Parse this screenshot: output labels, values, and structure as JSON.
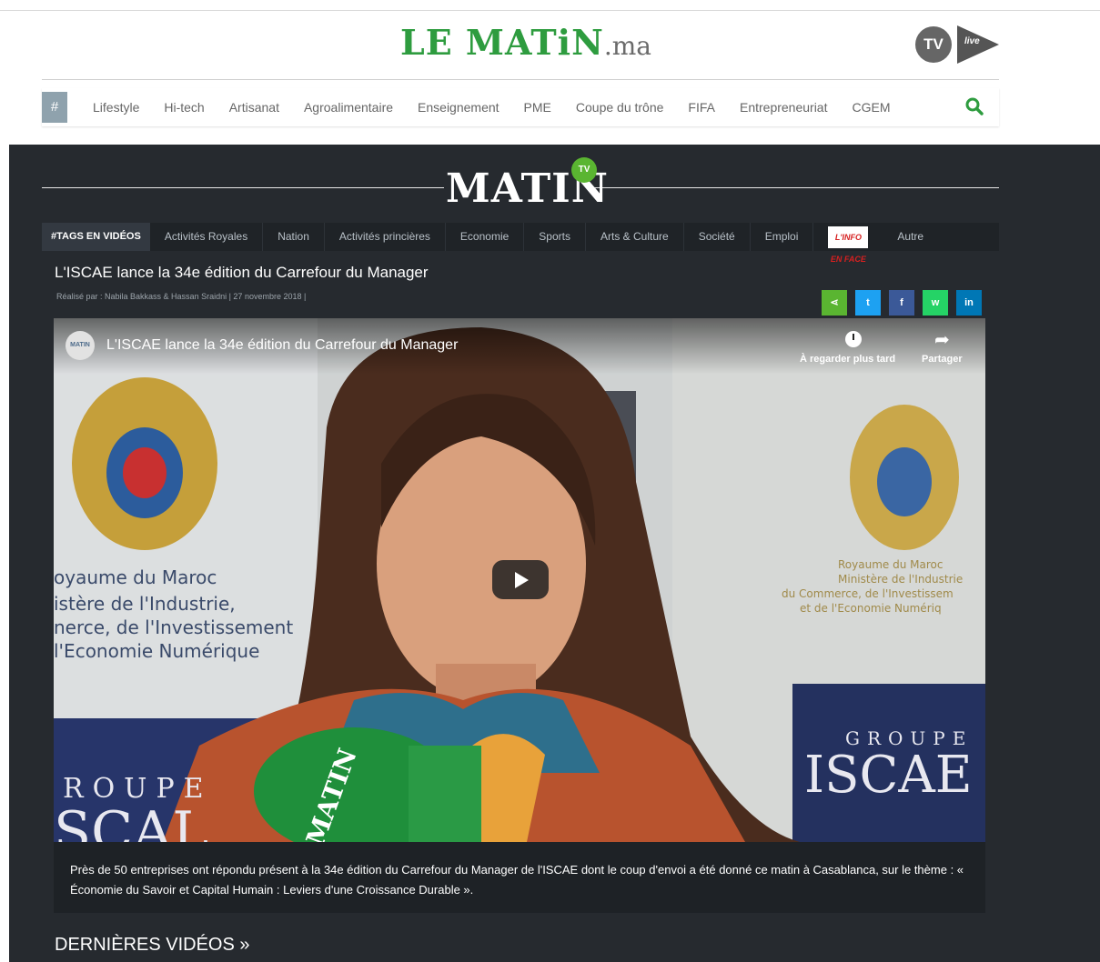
{
  "header": {
    "logo_main": "LE MATiN",
    "logo_ext": ".ma",
    "tv_label": "TV",
    "tv_play_text": "live"
  },
  "nav": {
    "hash_label": "#",
    "items": [
      "Lifestyle",
      "Hi-tech",
      "Artisanat",
      "Agroalimentaire",
      "Enseignement",
      "PME",
      "Coupe du trône",
      "FIFA",
      "Entrepreneuriat",
      "CGEM"
    ],
    "search_icon": "search-icon"
  },
  "matin_tv": {
    "logo": "MATIN",
    "badge": "TV"
  },
  "tags": {
    "first": "#TAGS EN VIDÉOS",
    "items": [
      "Activités Royales",
      "Nation",
      "Activités princières",
      "Economie",
      "Sports",
      "Arts & Culture",
      "Société",
      "Emploi"
    ],
    "linfo": "L'INFO EN FACE",
    "last": "Autre"
  },
  "article": {
    "title": "L'ISCAE lance la 34e édition du Carrefour du Manager",
    "meta": "Réalisé par : Nabila Bakkass & Hassan Sraidni  |  27 novembre 2018  |",
    "share_buttons": [
      {
        "name": "share-icon",
        "label": "⋖",
        "color": "#5ab531"
      },
      {
        "name": "twitter-icon",
        "label": "t",
        "color": "#1da1f2"
      },
      {
        "name": "facebook-icon",
        "label": "f",
        "color": "#3b5998"
      },
      {
        "name": "whatsapp-icon",
        "label": "w",
        "color": "#25d366"
      },
      {
        "name": "linkedin-icon",
        "label": "in",
        "color": "#0077b5"
      }
    ]
  },
  "video": {
    "channel": "MATIN",
    "title": "L'ISCAE lance la 34e édition du Carrefour du Manager",
    "watch_later": "À regarder plus tard",
    "share": "Partager",
    "wall_left": [
      "oyaume du Maroc",
      "istère de l'Industrie,",
      "nerce, de l'Investissement",
      "l'Economie Numérique"
    ],
    "wall_right": [
      "Royaume du Maroc",
      "Ministère de l'Industrie",
      "du Commerce, de l'Investissem",
      "et de l'Economie Numériq"
    ],
    "groupe_left": "ROUPE",
    "iscae_left": "SCAL",
    "groupe_right": "GROUPE",
    "iscae_right": "ISCAE",
    "mic_label": "MATIN"
  },
  "caption": "Près de 50 entreprises ont répondu présent à la 34e édition du Carrefour du Manager de l'ISCAE dont le coup d'envoi a été donné ce matin à Casablanca, sur le thème : « Économie du Savoir et Capital Humain : Leviers d'une Croissance Durable ».",
  "latest": "DERNIÈRES VIDÉOS »"
}
